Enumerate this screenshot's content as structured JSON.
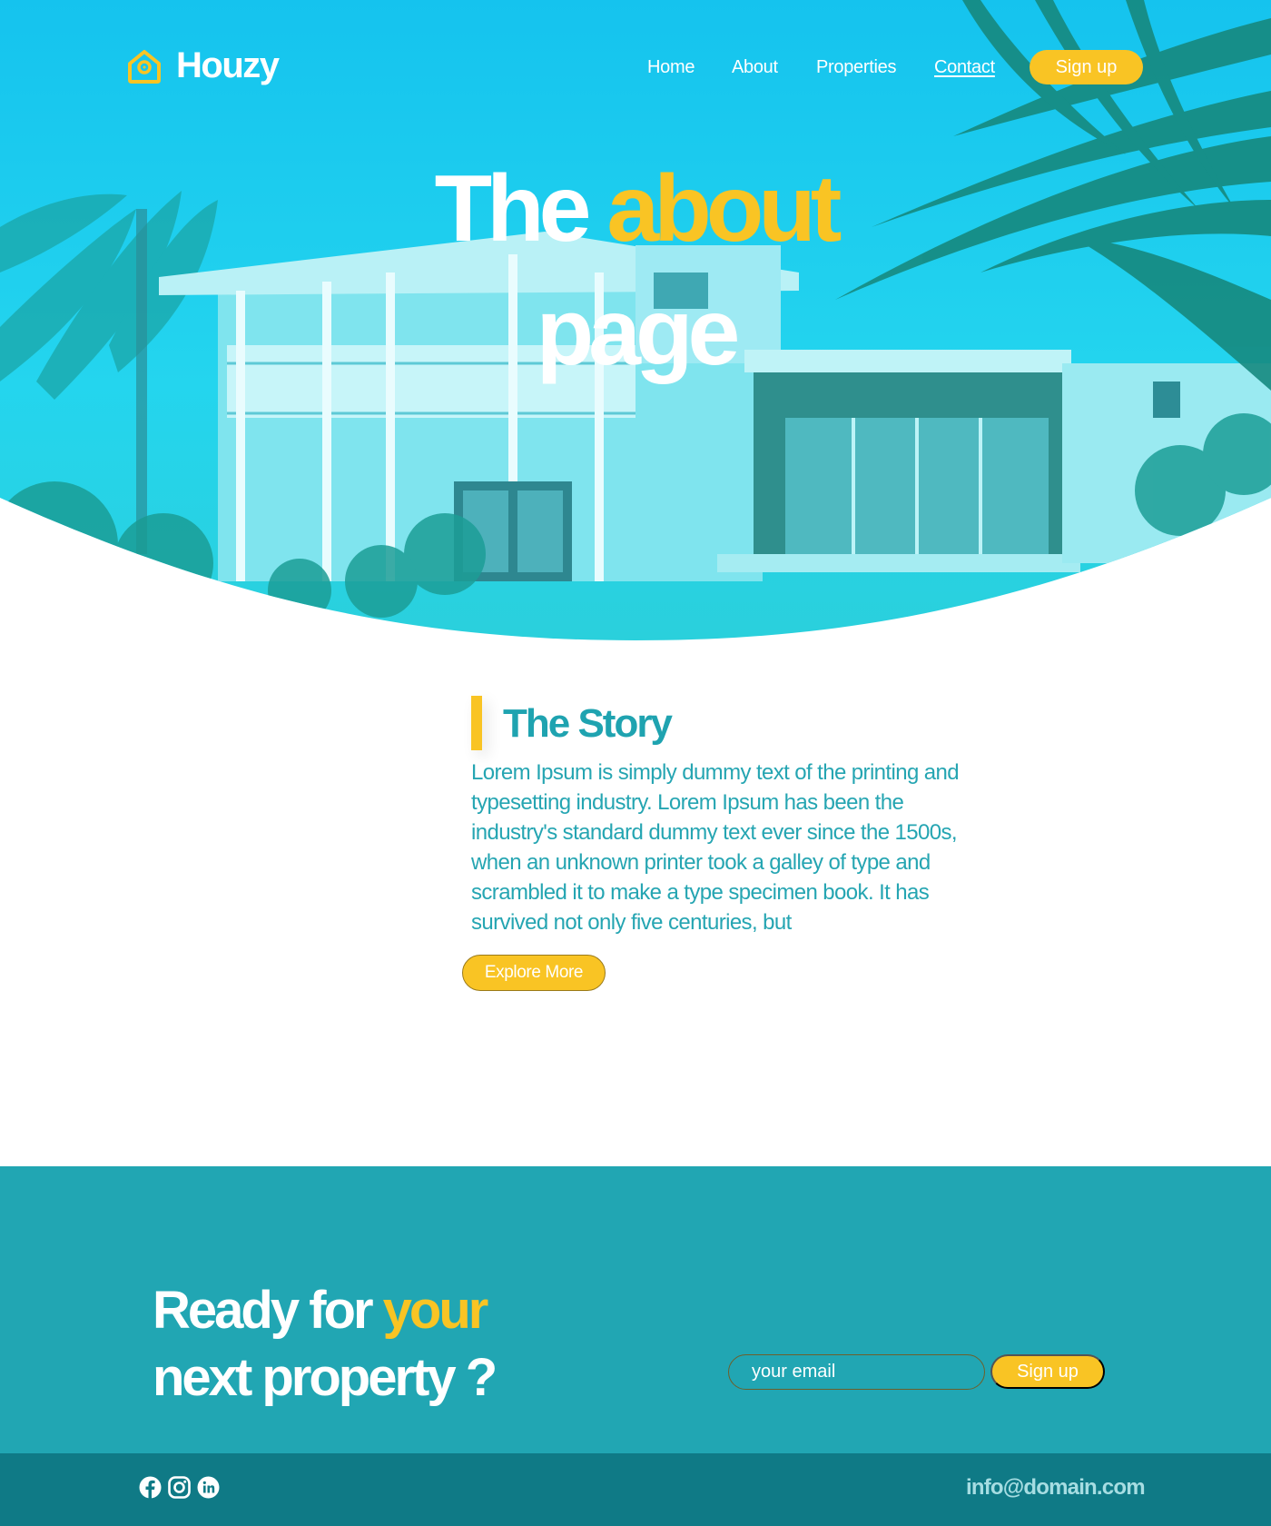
{
  "brand": {
    "name": "Houzy",
    "icon": "house-pin-icon"
  },
  "nav": {
    "items": [
      "Home",
      "About",
      "Properties",
      "Contact"
    ],
    "active": "Contact",
    "signup_label": "Sign up"
  },
  "hero": {
    "title_part1": "The",
    "title_accent": "about",
    "title_part2": "page"
  },
  "story": {
    "heading": "The Story",
    "body": "Lorem Ipsum is simply dummy text of the printing and typesetting industry. Lorem Ipsum has been the industry's standard dummy text ever since the 1500s, when an unknown printer took a galley of type and scrambled it to make a type specimen book. It has survived not only five centuries, but",
    "button_label": "Explore More"
  },
  "cta": {
    "title_part1": "Ready for",
    "title_accent": "your",
    "title_part2": "next property ?",
    "email_placeholder": "your email",
    "signup_label": "Sign up"
  },
  "footer": {
    "social_icons": [
      "facebook-icon",
      "instagram-icon",
      "linkedin-icon"
    ],
    "email": "info@domain.com"
  },
  "colors": {
    "accent_yellow": "#f9c424",
    "teal": "#21a6b3",
    "teal_dark": "#0f7a86",
    "hero_cyan": "#1ecbe8"
  }
}
